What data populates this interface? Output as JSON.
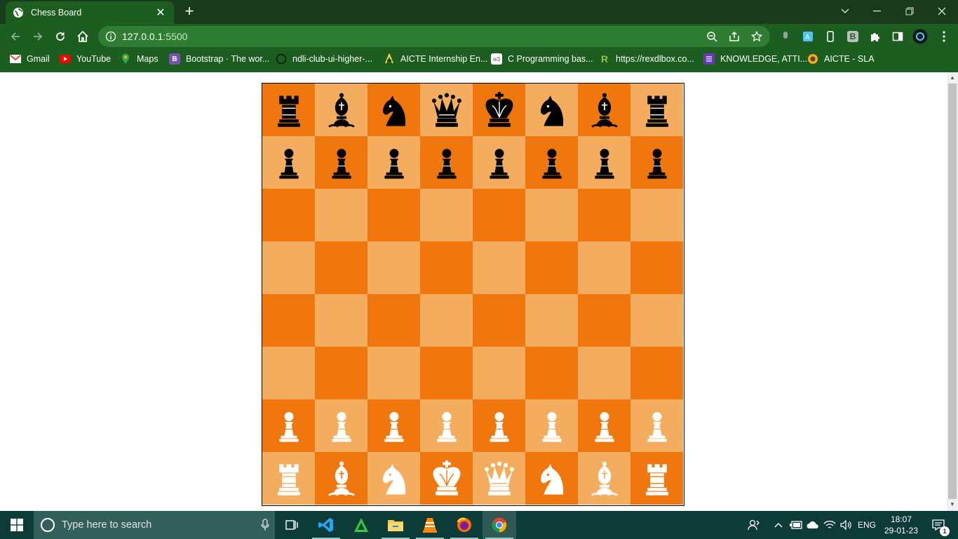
{
  "browser": {
    "tab_title": "Chess Board",
    "tab_close": "✕",
    "new_tab": "+",
    "url_host": "127.0.0.1",
    "url_port": ":5500",
    "bookmarks": [
      {
        "label": "Gmail",
        "icon": "gmail-icon"
      },
      {
        "label": "YouTube",
        "icon": "youtube-icon"
      },
      {
        "label": "Maps",
        "icon": "maps-icon"
      },
      {
        "label": "Bootstrap · The wor...",
        "icon": "bootstrap-icon"
      },
      {
        "label": "ndli-club-ui-higher-...",
        "icon": "globe-icon"
      },
      {
        "label": "AICTE Internship En...",
        "icon": "aicte-icon"
      },
      {
        "label": "C Programming bas...",
        "icon": "w3schools-icon"
      },
      {
        "label": "https://rexdlbox.co...",
        "icon": "rexdl-icon"
      },
      {
        "label": "KNOWLEDGE, ATTI...",
        "icon": "forms-icon"
      },
      {
        "label": "AICTE - SLA",
        "icon": "sla-icon"
      }
    ],
    "extension_badge": "B"
  },
  "colors": {
    "light_square": "#f4ad5e",
    "dark_square": "#f0770e",
    "black_piece": "#000000",
    "white_piece": "#ffffff",
    "chrome_bg": "#1b5e20"
  },
  "board": {
    "ranks": [
      [
        "black-rook",
        "black-bishop",
        "black-knight",
        "black-queen",
        "black-king",
        "black-knight",
        "black-bishop",
        "black-rook"
      ],
      [
        "black-pawn",
        "black-pawn",
        "black-pawn",
        "black-pawn",
        "black-pawn",
        "black-pawn",
        "black-pawn",
        "black-pawn"
      ],
      [
        "",
        "",
        "",
        "",
        "",
        "",
        "",
        ""
      ],
      [
        "",
        "",
        "",
        "",
        "",
        "",
        "",
        ""
      ],
      [
        "",
        "",
        "",
        "",
        "",
        "",
        "",
        ""
      ],
      [
        "",
        "",
        "",
        "",
        "",
        "",
        "",
        ""
      ],
      [
        "white-pawn",
        "white-pawn",
        "white-pawn",
        "white-pawn",
        "white-pawn",
        "white-pawn",
        "white-pawn",
        "white-pawn"
      ],
      [
        "white-rook",
        "white-bishop",
        "white-knight",
        "white-king",
        "white-queen",
        "white-knight",
        "white-bishop",
        "white-rook"
      ]
    ]
  },
  "taskbar": {
    "search_placeholder": "Type here to search",
    "apps": [
      "task-view-icon",
      "vscode-icon",
      "app-icon",
      "file-explorer-icon",
      "vlc-icon",
      "firefox-icon",
      "chrome-icon"
    ],
    "language": "ENG",
    "time": "18:07",
    "date": "29-01-23",
    "notification_count": "1"
  }
}
